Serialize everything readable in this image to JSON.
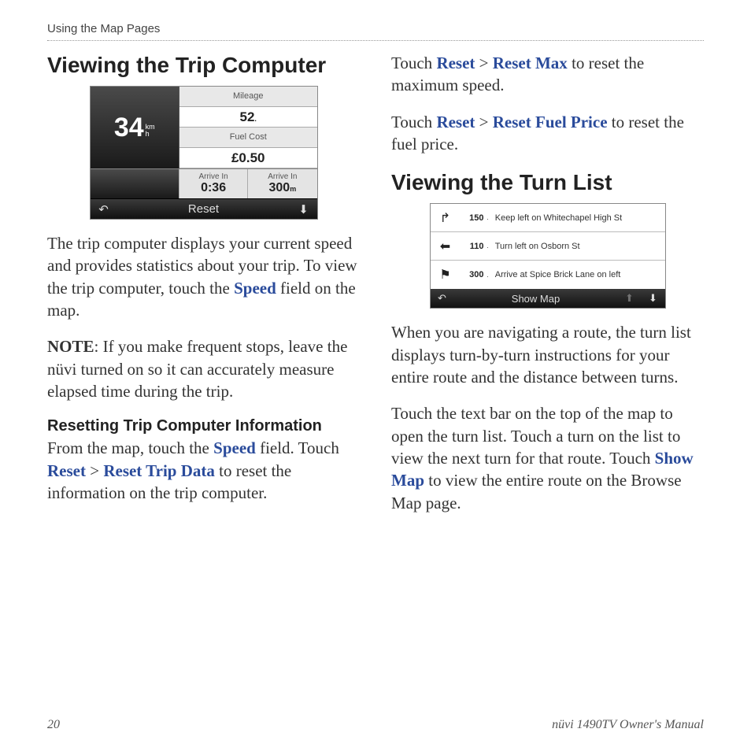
{
  "header": {
    "breadcrumb": "Using the Map Pages"
  },
  "footer": {
    "page": "20",
    "manual": "nüvi 1490TV Owner's Manual"
  },
  "left": {
    "h2": "Viewing the Trip Computer",
    "tc": {
      "speed": "34",
      "speed_unit": "km\nh",
      "mileage_label": "Mileage",
      "mileage_value": "52",
      "mileage_unit": ".",
      "fuel_label": "Fuel Cost",
      "fuel_value": "£0.50",
      "arrive_in_label": "Arrive In",
      "arrive_in_value": "0:36",
      "arrive_in2_label": "Arrive In",
      "arrive_in2_value": "300",
      "arrive_in2_unit": "m",
      "bar_back": "↶",
      "bar_mid": "Reset",
      "bar_down": "⬇"
    },
    "p1_a": "The trip computer displays your current speed and provides statistics about your trip. To view the trip computer, touch the ",
    "p1_link": "Speed",
    "p1_b": " field on the map.",
    "note_label": "NOTE",
    "note_body": ": If you make frequent stops, leave the nüvi turned on so it can accurately measure elapsed time during the trip.",
    "h3": "Resetting Trip Computer Information",
    "p2_a": "From the map, touch the ",
    "p2_speed": "Speed",
    "p2_b": " field. Touch ",
    "p2_reset": "Reset",
    "p2_gt": " > ",
    "p2_rtd": "Reset Trip Data",
    "p2_c": " to reset the information on the trip computer."
  },
  "right": {
    "p1_a": "Touch ",
    "p1_reset": "Reset",
    "p1_gt": " > ",
    "p1_rmax": "Reset Max",
    "p1_b": " to reset the maximum speed.",
    "p2_a": "Touch ",
    "p2_reset": "Reset",
    "p2_gt": " > ",
    "p2_rfp": "Reset Fuel Price",
    "p2_b": " to reset the fuel price.",
    "h2": "Viewing the Turn List",
    "tl": {
      "rows": [
        {
          "icon": "↱",
          "dist": "150",
          "unit": ".",
          "text": "Keep left on Whitechapel High St"
        },
        {
          "icon": "⬅",
          "dist": "110",
          "unit": ".",
          "text": "Turn left on Osborn St"
        },
        {
          "icon": "⚑",
          "dist": "300",
          "unit": ".",
          "text": "Arrive at Spice Brick Lane on left"
        }
      ],
      "bar_back": "↶",
      "bar_mid": "Show Map",
      "bar_up": "⬆",
      "bar_down": "⬇"
    },
    "p3": "When you are navigating a route, the turn list displays turn-by-turn instructions for your entire route and the distance between turns.",
    "p4_a": "Touch the text bar on the top of the map to open the turn list. Touch a turn on the list to view the next turn for that route. Touch ",
    "p4_link": "Show Map",
    "p4_b": " to view the entire route on the Browse Map page."
  }
}
